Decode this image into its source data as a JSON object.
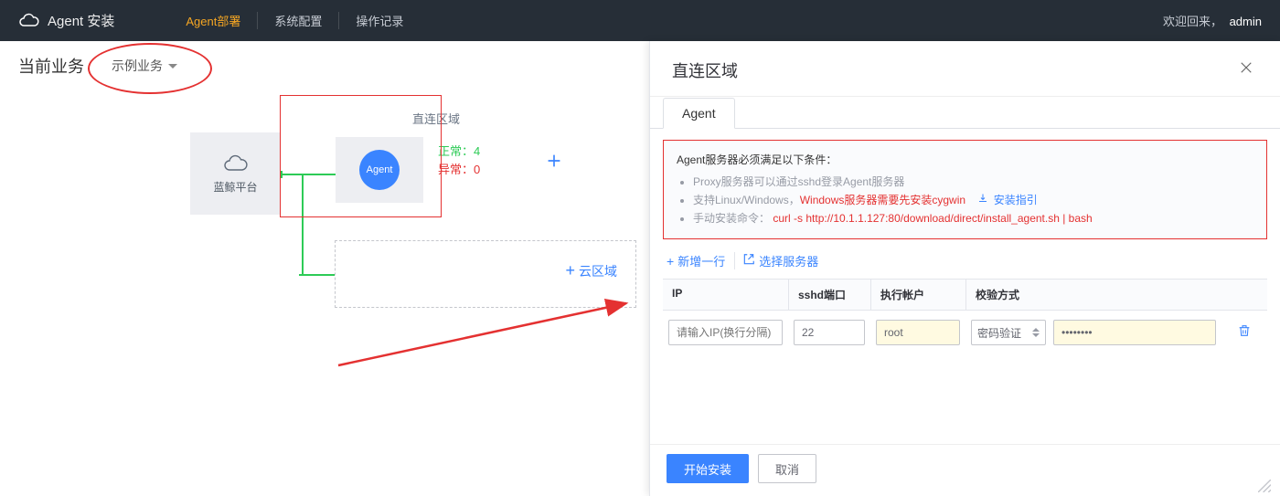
{
  "header": {
    "title": "Agent 安装",
    "nav": [
      {
        "label": "Agent部署",
        "active": true
      },
      {
        "label": "系统配置",
        "active": false
      },
      {
        "label": "操作记录",
        "active": false
      }
    ],
    "welcome_prefix": "欢迎回来，",
    "username": "admin"
  },
  "biz": {
    "label": "当前业务",
    "selected": "示例业务"
  },
  "topology": {
    "platform_label": "蓝鲸平台",
    "direct_area_label": "直连区域",
    "agent_label": "Agent",
    "status_normal_label": "正常：",
    "status_normal_value": "4",
    "status_abnormal_label": "异常：",
    "status_abnormal_value": "0",
    "cloud_area_label": "云区域"
  },
  "drawer": {
    "title": "直连区域",
    "tab_label": "Agent",
    "requirements": {
      "title": "Agent服务器必须满足以下条件：",
      "items": [
        {
          "type": "plain",
          "text": "Proxy服务器可以通过sshd登录Agent服务器"
        },
        {
          "type": "win",
          "pre": "支持Linux/Windows，",
          "red": "Windows服务器需要先安装cygwin",
          "link": "安装指引"
        },
        {
          "type": "cmd",
          "pre": "手动安装命令：",
          "cmd": "curl -s http://10.1.1.127:80/download/direct/install_agent.sh | bash"
        }
      ]
    },
    "toolbar": {
      "add_row": "新增一行",
      "select_server": "选择服务器"
    },
    "columns": {
      "ip": "IP",
      "port": "sshd端口",
      "user": "执行帐户",
      "auth": "校验方式"
    },
    "row": {
      "ip_placeholder": "请输入IP(换行分隔)",
      "ip_value": "",
      "port_value": "22",
      "user_value": "root",
      "auth_value": "密码验证",
      "password_value": "••••••••"
    },
    "footer": {
      "submit": "开始安装",
      "cancel": "取消"
    }
  }
}
